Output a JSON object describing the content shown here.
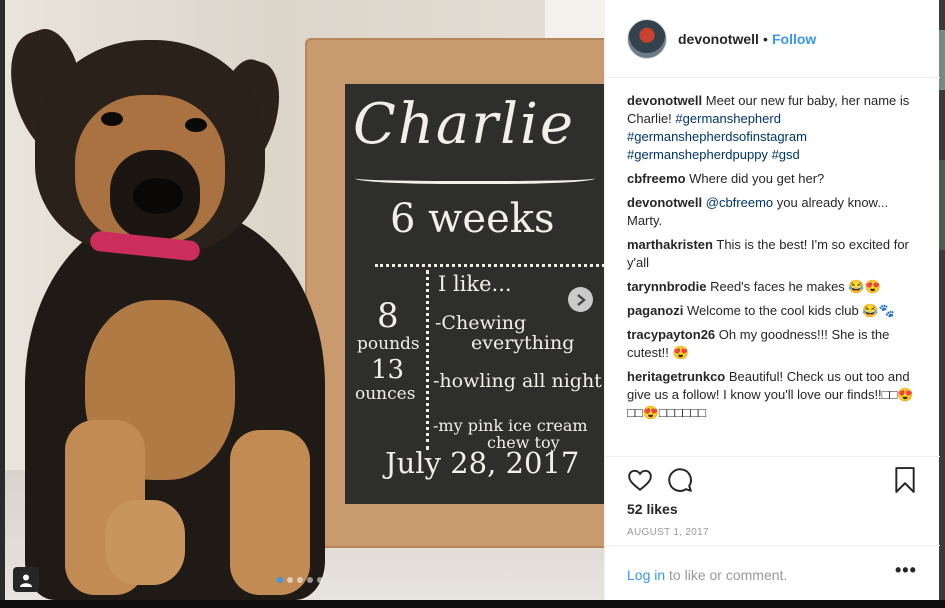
{
  "post": {
    "username": "devonotwell",
    "separator": "•",
    "follow_label": "Follow",
    "likes": "52 likes",
    "date": "AUGUST 1, 2017",
    "login_link": "Log in",
    "login_rest": " to like or comment.",
    "more_label": "•••"
  },
  "photo": {
    "board": {
      "name": "Charlie",
      "weeks": "6 weeks",
      "i_like": "I like...",
      "like_1a": "-Chewing",
      "like_1b": "everything",
      "like_2": "-howling all night",
      "like_3a": "-my pink ice cream",
      "like_3b": "chew toy",
      "weight_1": "8",
      "weight_2": "pounds",
      "weight_3": "13",
      "weight_4": "ounces",
      "date": "July 28, 2017"
    },
    "carousel": {
      "count": 5,
      "active": 1
    }
  },
  "comments": [
    {
      "user": "devonotwell",
      "text": "Meet our new fur baby, her name is Charlie!",
      "tags": [
        "#germanshepherd",
        "#germanshepherdsofinstagram",
        "#germanshepherdpuppy",
        "#gsd"
      ]
    },
    {
      "user": "cbfreemo",
      "text": "Where did you get her?"
    },
    {
      "user": "devonotwell",
      "mention": "@cbfreemo",
      "text": "you already know... Marty."
    },
    {
      "user": "marthakristen",
      "text": "This is the best! I'm so excited for y'all"
    },
    {
      "user": "tarynnbrodie",
      "text": "Reed's faces he makes 😂😍"
    },
    {
      "user": "paganozi",
      "text": "Welcome to the cool kids club 😂🐾"
    },
    {
      "user": "tracypayton26",
      "text": "Oh my goodness!!! She is the cutest!! 😍"
    },
    {
      "user": "heritagetrunkco",
      "text": "Beautiful! Check us out too and give us a follow! I know you'll love our finds!!□□😍□□😍□□□□□□"
    }
  ],
  "icons": {
    "heart": "heart-icon",
    "comment": "comment-icon",
    "bookmark": "bookmark-icon",
    "next": "chevron-right-icon",
    "tag": "user-tag-icon"
  },
  "colors": {
    "link": "#003569",
    "accent": "#3897f0",
    "muted": "#999999"
  }
}
